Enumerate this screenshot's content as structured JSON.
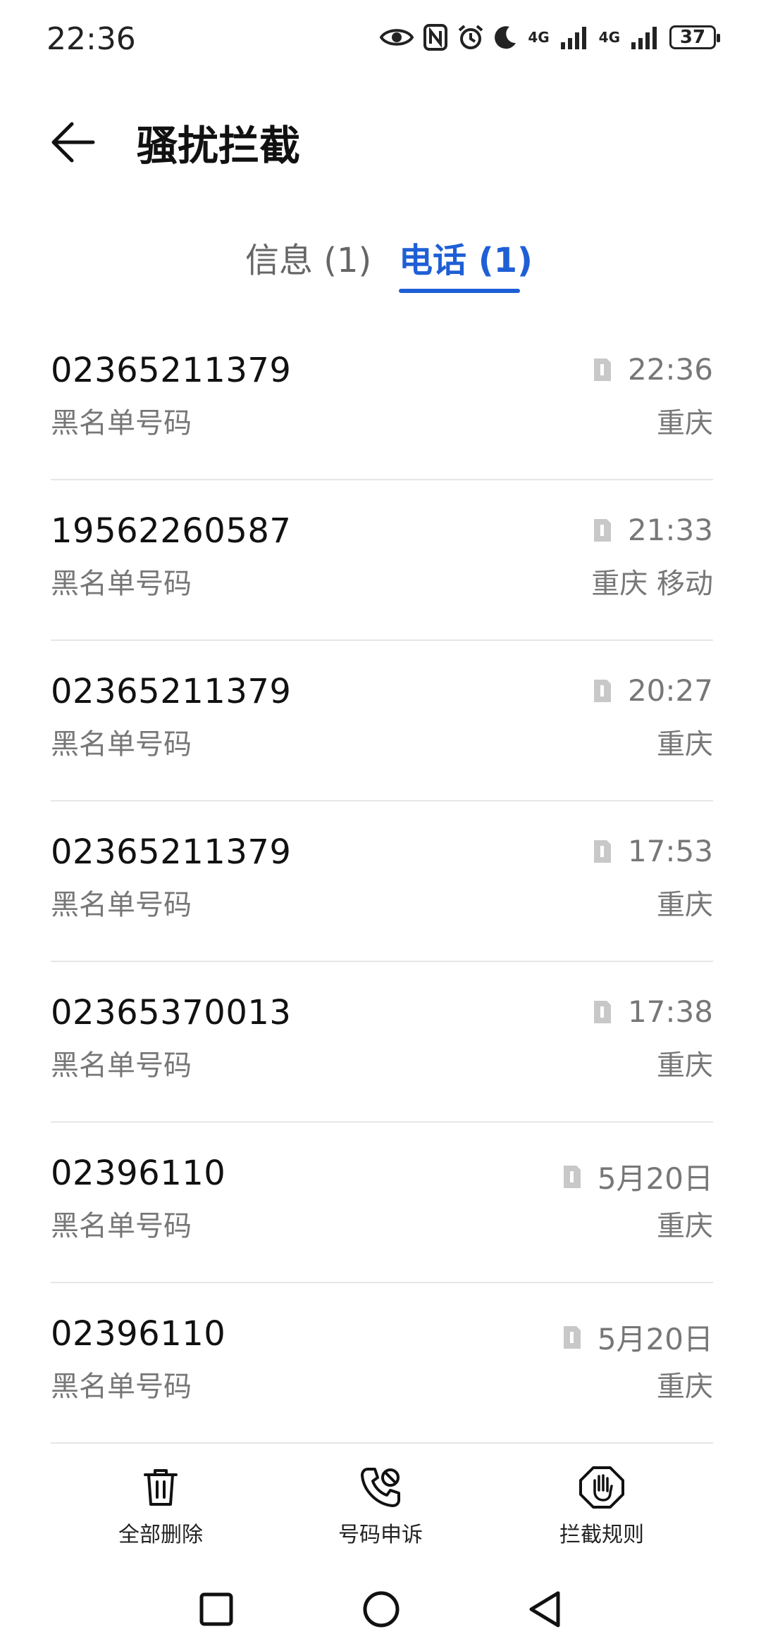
{
  "status_bar": {
    "time": "22:36",
    "battery_level": "37",
    "network_labels": [
      "4G",
      "4G"
    ],
    "icons": [
      "eye-icon",
      "nfc-icon",
      "alarm-icon",
      "moon-icon",
      "signal-icon",
      "signal-icon",
      "battery-icon"
    ]
  },
  "header": {
    "title": "骚扰拦截",
    "back_icon": "arrow-left-icon"
  },
  "tabs": [
    {
      "label": "信息 (1)",
      "active": false
    },
    {
      "label": "电话 (1)",
      "active": true
    }
  ],
  "accent_color": "#1f5fd6",
  "calls": [
    {
      "number": "02365211379",
      "tag": "黑名单号码",
      "time": "22:36",
      "location": "重庆"
    },
    {
      "number": "19562260587",
      "tag": "黑名单号码",
      "time": "21:33",
      "location": "重庆 移动"
    },
    {
      "number": "02365211379",
      "tag": "黑名单号码",
      "time": "20:27",
      "location": "重庆"
    },
    {
      "number": "02365211379",
      "tag": "黑名单号码",
      "time": "17:53",
      "location": "重庆"
    },
    {
      "number": "02365370013",
      "tag": "黑名单号码",
      "time": "17:38",
      "location": "重庆"
    },
    {
      "number": "02396110",
      "tag": "黑名单号码",
      "time": "5月20日",
      "location": "重庆"
    },
    {
      "number": "02396110",
      "tag": "黑名单号码",
      "time": "5月20日",
      "location": "重庆"
    }
  ],
  "bottom_actions": [
    {
      "label": "全部删除",
      "icon": "trash-icon"
    },
    {
      "label": "号码申诉",
      "icon": "phone-appeal-icon"
    },
    {
      "label": "拦截规则",
      "icon": "hand-stop-icon"
    }
  ]
}
